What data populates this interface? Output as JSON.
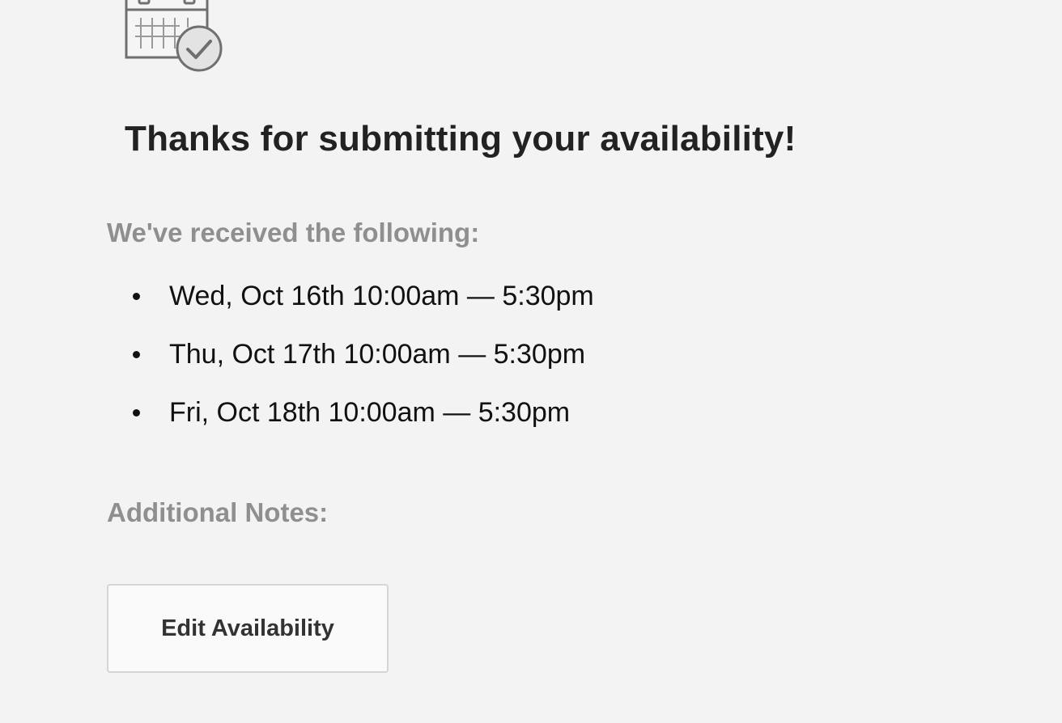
{
  "icons": {
    "header_icon": "calendar-check-icon"
  },
  "confirmation": {
    "title": "Thanks for submitting your availability!",
    "received_heading": "We've received the following:",
    "availability": [
      {
        "label": "Wed, Oct 16th 10:00am — 5:30pm"
      },
      {
        "label": "Thu, Oct 17th 10:00am — 5:30pm"
      },
      {
        "label": "Fri, Oct 18th 10:00am — 5:30pm"
      }
    ],
    "notes_heading": "Additional Notes:",
    "notes_text": ""
  },
  "actions": {
    "edit_label": "Edit Availability"
  },
  "colors": {
    "background": "#f3f3f3",
    "title": "#222222",
    "section_heading": "#8f8f8f",
    "body_text": "#111111",
    "button_background": "#fafafa",
    "button_border": "#d5d5d5",
    "icon_stroke": "#6f6f6f"
  }
}
